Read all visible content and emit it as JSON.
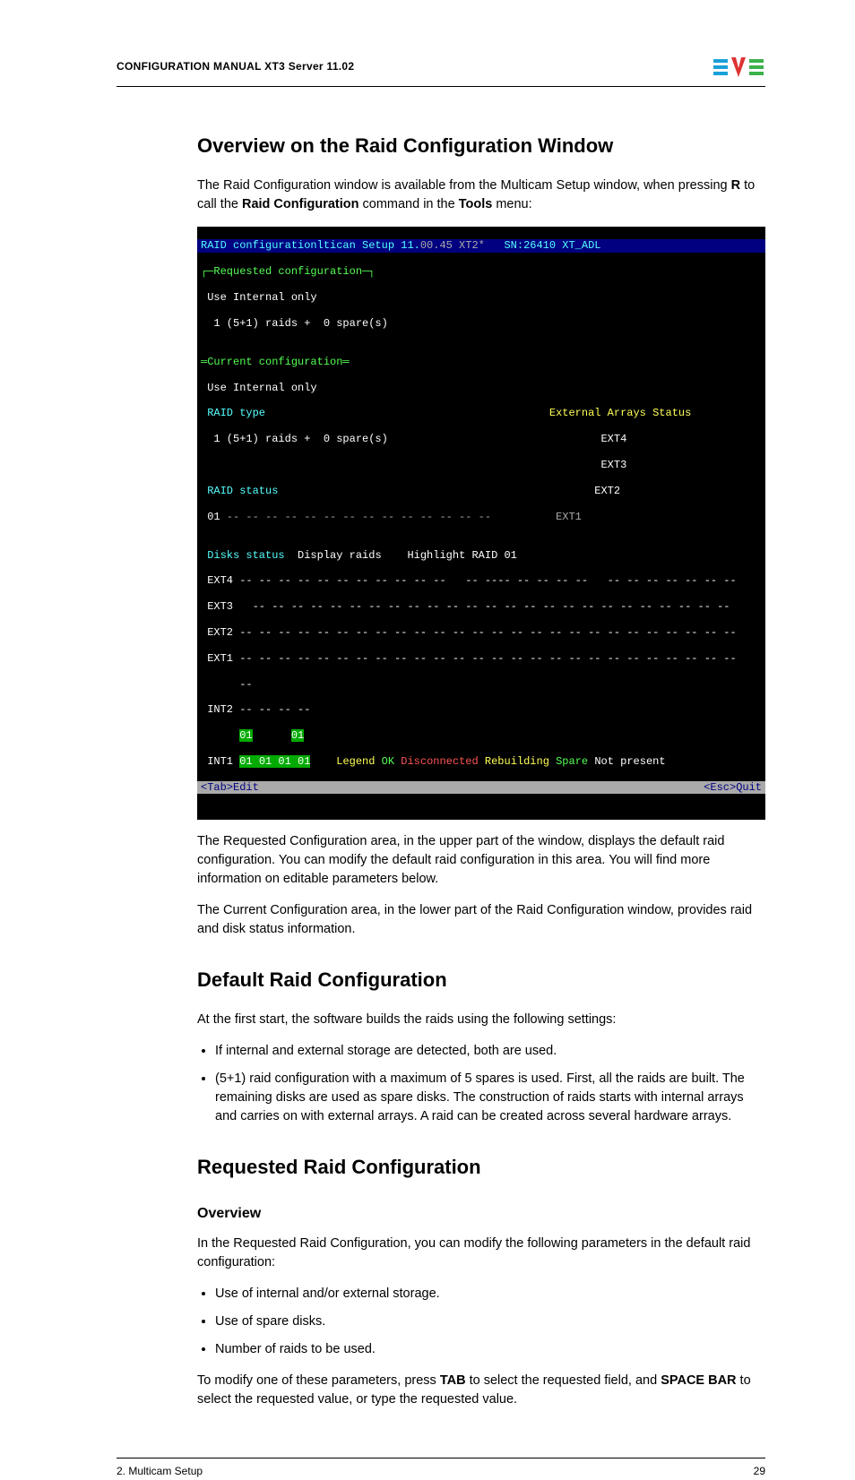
{
  "header": {
    "title": "CONFIGURATION MANUAL XT3 Server 11.02"
  },
  "h_overview": "Overview on the Raid Configuration Window",
  "p_intro1a": "The Raid Configuration window is available from the Multicam Setup window, when pressing ",
  "p_intro1_R": "R",
  "p_intro1b": " to call the ",
  "p_intro1_RC": "Raid Configuration",
  "p_intro1c": " command in the ",
  "p_intro1_Tools": "Tools",
  "p_intro1d": " menu:",
  "term": {
    "t01a": "RAID configurationltican Setup 11.",
    "t01b": "00.45 XT2*",
    "t01c": "   SN:26410 XT_ADL",
    "t02": "┌─Requested configuration─┐",
    "t03": " Use Internal only",
    "t04": "  1 (5+1) raids +  0 spare(s)",
    "t05": "",
    "t06": "═Current configuration═",
    "t07": " Use Internal only",
    "t08a": " RAID type",
    "t08b": "                                            External Arrays Status",
    "t09a": "  1 (5+1) raids +  0 spare(s)",
    "t09b": "                                 EXT4",
    "t10": "                                                              EXT3",
    "t11a": " RAID status",
    "t11b": "                                                 EXT2",
    "t12a": " 01",
    "t12b": " -- -- -- -- -- -- -- -- -- -- -- -- -- --          EXT1",
    "t13l": " Disks status",
    "t13m": "  Display raids    ",
    "t13r": "Highlight RAID 01",
    "t14": " EXT4 -- -- -- -- -- -- -- -- -- -- --   -- ---- -- -- -- --   -- -- -- -- -- -- --",
    "t15": " EXT3   -- -- -- -- -- -- -- -- -- -- -- -- -- -- -- -- -- -- -- -- -- -- -- -- --",
    "t16": " EXT2 -- -- -- -- -- -- -- -- -- -- -- -- -- -- -- -- -- -- -- -- -- -- -- -- -- --",
    "t17": " EXT1 -- -- -- -- -- -- -- -- -- -- -- -- -- -- -- -- -- -- -- -- -- -- -- -- -- --",
    "t17b": "      --",
    "t18": " INT2 -- -- -- --",
    "t19a": "      ",
    "t19b": "01",
    "t19c": "      ",
    "t19d": "01",
    "t20a": " INT1 ",
    "t20b": "01 01 01 01",
    "t20c": "    Legend ",
    "t20d": "OK ",
    "t20e": "Disconnected ",
    "t20f": "Rebuilding ",
    "t20g": "Spare ",
    "t20h": "Not present",
    "t21a": "<Tab>Edit",
    "t21b": "<Esc>Quit"
  },
  "p_after1": "The Requested Configuration area, in the upper part of the window, displays the default raid configuration. You can modify the default raid configuration in this area. You will find more information on editable parameters below.",
  "p_after2": "The Current Configuration area, in the lower part of the Raid Configuration window, provides raid and disk status information.",
  "h_default": "Default Raid Configuration",
  "p_def1": "At the first start, the software builds the raids using the following settings:",
  "li_def1": "If internal and external storage are detected, both are used.",
  "li_def2": "(5+1) raid configuration with a maximum of 5 spares is used. First, all the raids are built. The remaining disks are used as spare disks. The construction of raids starts with internal arrays and carries on with external arrays. A raid can be created across several hardware arrays.",
  "h_req": "Requested Raid Configuration",
  "h_req_ov": "Overview",
  "p_req1": "In the Requested Raid Configuration, you can modify the following parameters in the default raid configuration:",
  "li_req1": "Use of internal and/or external storage.",
  "li_req2": "Use of spare disks.",
  "li_req3": "Number of raids to be used.",
  "p_req2a": "To modify one of these parameters, press ",
  "p_req2_TAB": "TAB",
  "p_req2b": " to select the requested field, and ",
  "p_req2_SB": "SPACE BAR",
  "p_req2c": " to select the requested value, or type the requested value.",
  "footer": {
    "left": "2. Multicam Setup",
    "right": "29"
  }
}
